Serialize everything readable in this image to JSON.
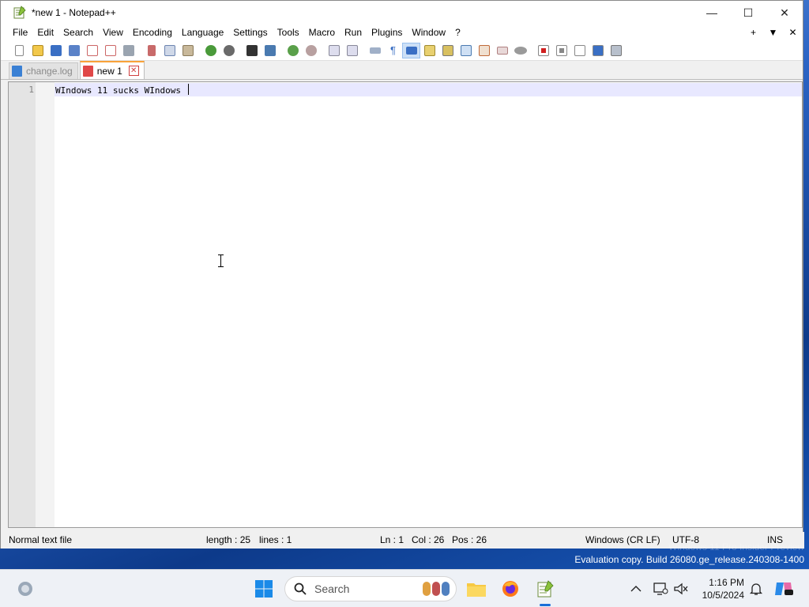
{
  "window": {
    "title": "*new 1 - Notepad++",
    "controls": {
      "minimize": "—",
      "maximize": "☐",
      "close": "✕"
    }
  },
  "menu": {
    "items": [
      "File",
      "Edit",
      "Search",
      "View",
      "Encoding",
      "Language",
      "Settings",
      "Tools",
      "Macro",
      "Run",
      "Plugins",
      "Window",
      "?"
    ],
    "right": [
      "+",
      "▼",
      "✕"
    ]
  },
  "toolbar": {
    "buttons": [
      "new-file",
      "open-file",
      "save",
      "save-all",
      "close",
      "close-all",
      "print",
      "cut",
      "copy",
      "paste",
      "undo",
      "redo",
      "find",
      "replace",
      "zoom-in",
      "zoom-out",
      "sync-vertical",
      "sync-horizontal",
      "word-wrap",
      "show-all-characters",
      "indent-guide",
      "document-map",
      "function-list",
      "doc-switcher",
      "folder-as-workspace",
      "monitoring",
      "launch-browser",
      "record-macro",
      "stop-recording",
      "playback-macro",
      "run-macro-multiple",
      "save-macro"
    ]
  },
  "tabs": [
    {
      "label": "change.log",
      "active": false
    },
    {
      "label": "new 1",
      "active": true
    }
  ],
  "editor": {
    "line_number": "1",
    "content": "WIndows 11 sucks WIndows "
  },
  "status": {
    "file_type": "Normal text file",
    "length": "length : 25",
    "lines": "lines : 1",
    "ln": "Ln : 1",
    "col": "Col : 26",
    "pos": "Pos : 26",
    "eol": "Windows (CR LF)",
    "encoding": "UTF-8",
    "mode": "INS"
  },
  "watermark": {
    "line1": "Windows 11 Pro Insider Preview",
    "line2": "Evaluation copy. Build 26080.ge_release.240308-1400"
  },
  "taskbar": {
    "search_placeholder": "Search",
    "time": "1:16 PM",
    "date": "10/5/2024"
  },
  "colors": {
    "active_tab_accent": "#f9a23a",
    "current_line": "#e8e8ff",
    "taskbar": "#eef1f6"
  }
}
